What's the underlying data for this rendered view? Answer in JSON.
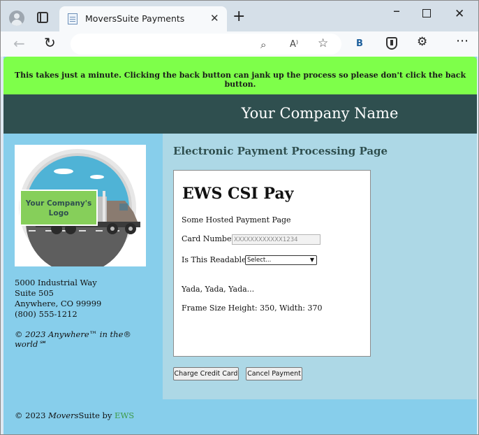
{
  "browser": {
    "tab_title": "MoversSuite Payments",
    "tab_close": "✕",
    "new_tab": "+",
    "window_controls": {
      "minimize": "–",
      "close": "✕"
    },
    "nav": {
      "back": "←",
      "refresh": "↻"
    },
    "address_icons": {
      "zoom": "⌕",
      "read_aloud": "A⁾",
      "favorite": "☆"
    },
    "toolbar": {
      "extension_b": "B",
      "extensions": "⚙",
      "more": "⋯"
    }
  },
  "banner": {
    "text": "This takes just a minute. Clicking the back button can jank up the process so please don't click the back button.",
    "color": "#7eff4a"
  },
  "header": {
    "title": "Your Company Name",
    "color": "#2f4f4f"
  },
  "sidebar": {
    "logo_text_line1": "Your Company's",
    "logo_text_line2": "Logo",
    "address_line1": "5000 Industrial Way",
    "address_line2": "Suite 505",
    "address_line3": "Anywhere, CO 99999",
    "phone": "(800) 555-1212",
    "tagline": "© 2023 Anywhere™ in the® world℠",
    "color": "#87ceeb"
  },
  "main": {
    "heading": "Electronic Payment Processing Page",
    "color": "#add8e6",
    "frame": {
      "title": "EWS CSI Pay",
      "hosted_text": "Some Hosted Payment Page",
      "card_label": "Card Number:",
      "card_value": "XXXXXXXXXXXX1234",
      "readable_label": "Is This Readable?:",
      "readable_selected": "Select...",
      "yada": "Yada, Yada, Yada...",
      "frame_size": "Frame Size Height: 350, Width: 370"
    },
    "buttons": {
      "charge": "Charge Credit Card",
      "cancel": "Cancel Payment"
    }
  },
  "footer": {
    "prefix": "© 2023 ",
    "brand_italic": "Movers",
    "brand_rest": "Suite by ",
    "ews": "EWS"
  }
}
